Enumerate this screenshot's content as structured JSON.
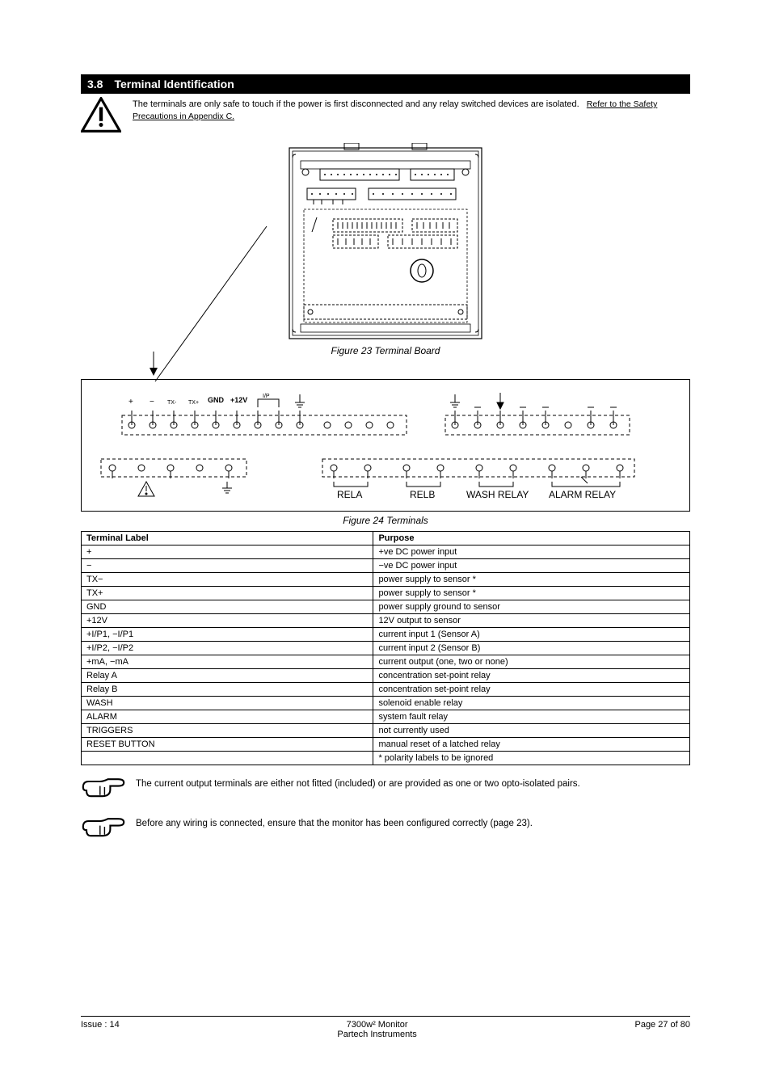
{
  "header": {
    "section_num": "3.8",
    "title": "Terminal Identification"
  },
  "warning": {
    "text": "The terminals are only safe to touch if the power is first disconnected and any relay switched devices are isolated.",
    "link_text": "Refer to the Safety Precautions in Appendix C."
  },
  "fig23": {
    "caption": "Figure 23 Terminal Board"
  },
  "fig24": {
    "caption": "Figure 24 Terminals"
  },
  "diagram_top": {
    "gnd": "GND",
    "v12": "+12V"
  },
  "diagram_bottom": {
    "rela": "RELA",
    "relb": "RELB",
    "wash": "WASH RELAY",
    "alarm": "ALARM RELAY"
  },
  "table": {
    "h1": "Terminal Label",
    "h2": "Purpose",
    "rows": [
      [
        "+",
        "+ve DC power input"
      ],
      [
        "−",
        "−ve DC power input"
      ],
      [
        "TX−",
        "power supply to sensor *"
      ],
      [
        "TX+",
        "power supply to sensor *"
      ],
      [
        "GND",
        "power supply ground to sensor"
      ],
      [
        "+12V",
        "12V output to sensor"
      ],
      [
        "+I/P1, −I/P1",
        "current input 1 (Sensor A)"
      ],
      [
        "+I/P2, −I/P2",
        "current input 2 (Sensor B)"
      ],
      [
        "+mA, −mA",
        "current output (one, two or none)"
      ],
      [
        "Relay A",
        "concentration set-point relay"
      ],
      [
        "Relay B",
        "concentration set-point relay"
      ],
      [
        "WASH",
        "solenoid enable relay"
      ],
      [
        "ALARM",
        "system fault relay"
      ],
      [
        "TRIGGERS",
        "not currently used"
      ],
      [
        "RESET BUTTON",
        "manual reset of a latched relay"
      ]
    ],
    "last_row": [
      "",
      "* polarity labels to be ignored"
    ]
  },
  "notes": [
    "The current output terminals are either not fitted (included) or are provided as one or two opto-isolated pairs.",
    "Before any wiring is connected, ensure that the monitor has been configured correctly (page 23)."
  ],
  "icons": {
    "warning_name": "warning-triangle-icon",
    "note_name": "pointing-hand-icon"
  },
  "footer": {
    "left": "Issue : 14",
    "mid_line1": "7300w² Monitor",
    "mid_line2": "Partech Instruments",
    "right": "Page 27 of 80"
  }
}
